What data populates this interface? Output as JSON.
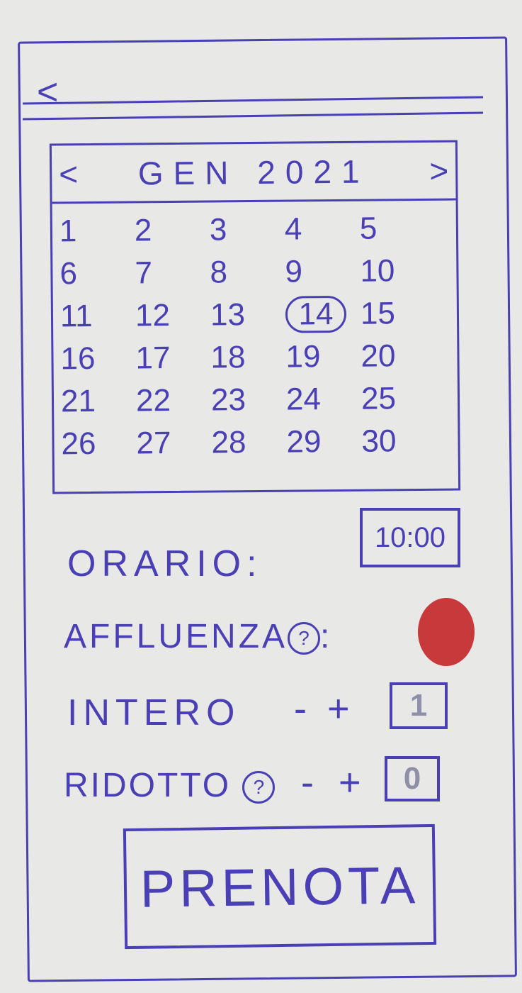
{
  "header": {
    "back_icon": "<"
  },
  "calendar": {
    "prev": "<",
    "next": ">",
    "month": "GEN",
    "year": "2021",
    "days": [
      "1",
      "2",
      "3",
      "4",
      "5",
      "6",
      "7",
      "8",
      "9",
      "10",
      "11",
      "12",
      "13",
      "14",
      "15",
      "16",
      "17",
      "18",
      "19",
      "20",
      "21",
      "22",
      "23",
      "24",
      "25",
      "26",
      "27",
      "28",
      "29",
      "30"
    ],
    "selected_day": "14"
  },
  "orario": {
    "label": "ORARIO:",
    "value": "10:00"
  },
  "affluenza": {
    "label": "AFFLUENZA",
    "help": "?",
    "colon": ":",
    "status_color": "#c8393c"
  },
  "intero": {
    "label": "INTERO",
    "minus": "-",
    "plus": "+",
    "value": "1"
  },
  "ridotto": {
    "label": "RIDOTTO",
    "help": "?",
    "minus": "-",
    "plus": "+",
    "value": "0"
  },
  "submit": {
    "label": "PRENOTA"
  }
}
